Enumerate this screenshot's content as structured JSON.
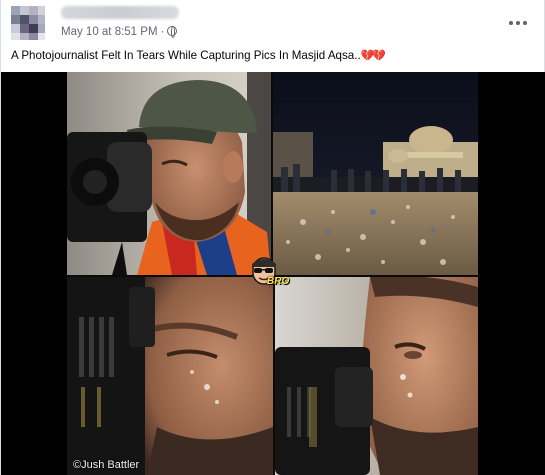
{
  "post": {
    "author_name": "",
    "timestamp": "May 10 at 8:51 PM",
    "separator": "·",
    "audience_icon": "globe-icon",
    "more_icon": "more-options-icon",
    "caption": "A Photojournalist Felt In Tears While Capturing Pics In Masjid Aqsa..",
    "caption_emoji": "💔💔"
  },
  "image": {
    "watermark_credit": "©Jush Battler",
    "badge_text": "BRO"
  },
  "colors": {
    "text_primary": "#050505",
    "text_secondary": "#65676b",
    "heart": "#d62839",
    "media_background": "#000000"
  }
}
